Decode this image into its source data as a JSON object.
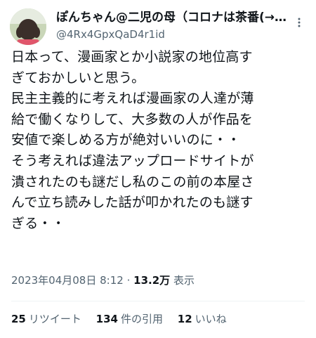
{
  "tweet": {
    "author": {
      "display_name": "ぽんちゃん@二児の母（コロナは茶番(→mRNAは危険)）",
      "handle": "@4Rx4GpxQaD4r1id"
    },
    "body_lines": [
      "日本って、漫画家とか小説家の地位高す",
      "ぎておかしいと思う。",
      "民主主義的に考えれば漫画家の人達が薄",
      "給で働くなりして、大多数の人が作品を",
      "安値で楽しめる方が絶対いいのに・・",
      "そう考えれば違法アップロードサイトが",
      "潰されたのも謎だし私のこの前の本屋さ",
      "んで立ち読みした話が叩かれたのも謎す",
      "ぎる・・"
    ],
    "timestamp": "2023年04月08日 8:12",
    "separator": "·",
    "views": {
      "count": "13.2万",
      "label": "表示"
    },
    "stats": {
      "retweets": {
        "count": "25",
        "label": "リツイート"
      },
      "quotes": {
        "count": "134",
        "label": "件の引用"
      },
      "likes": {
        "count": "12",
        "label": "いいね"
      }
    }
  },
  "icons": {
    "more": "more-vertical-icon",
    "avatar": "avatar-child-photo"
  },
  "colors": {
    "text_primary": "#0f1419",
    "text_secondary": "#536471",
    "divider": "#eff3f4"
  }
}
